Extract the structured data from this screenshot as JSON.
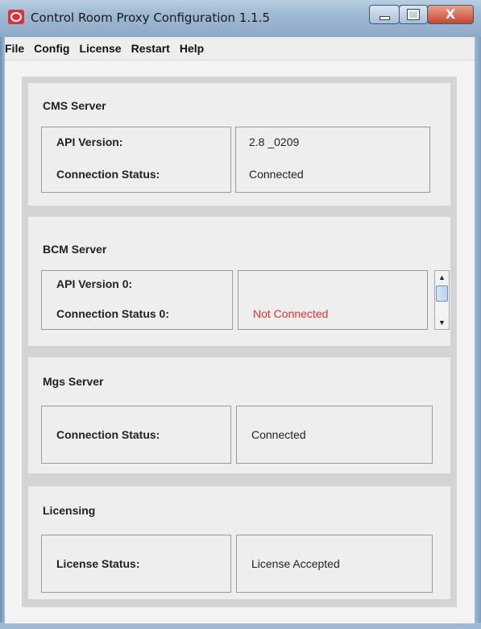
{
  "window": {
    "title": "Control Room Proxy Configuration 1.1.5",
    "close_glyph": "X"
  },
  "menu": [
    "File",
    "Config",
    "License",
    "Restart",
    "Help"
  ],
  "cms": {
    "title": "CMS Server",
    "api_label": "API Version:",
    "status_label": "Connection Status:",
    "api_value": "2.8 _0209",
    "status_value": "Connected"
  },
  "bcm": {
    "title": "BCM Server",
    "api_label": "API Version 0:",
    "status_label": "Connection Status 0:",
    "status_value": "Not Connected",
    "status_color": "#e03030"
  },
  "mgs": {
    "title": "Mgs Server",
    "status_label": "Connection Status:",
    "status_value": "Connected"
  },
  "licensing": {
    "title": "Licensing",
    "status_label": "License Status:",
    "status_value": "License Accepted"
  },
  "icons": {
    "app": "app-logo-icon",
    "scroll_up": "scroll-up-icon",
    "scroll_down": "scroll-down-icon"
  },
  "colors": {
    "error": "#e03030",
    "close_button": "#c9452e",
    "titlebar": "#9fb9d3"
  }
}
